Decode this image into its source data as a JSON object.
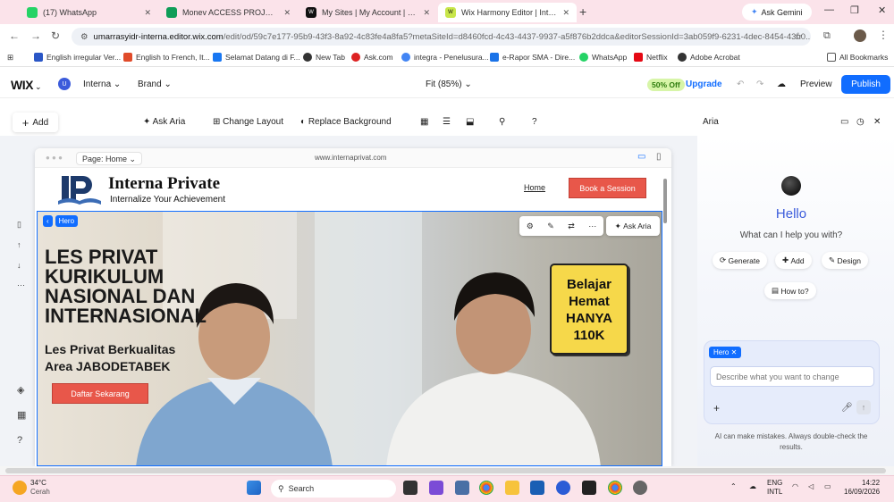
{
  "browser": {
    "tabs": [
      {
        "title": "(17) WhatsApp",
        "icon": "whatsapp-icon",
        "color": "#25d366"
      },
      {
        "title": "Monev ACCESS PROJECT 2026 -",
        "icon": "sheets-icon",
        "color": "#0f9d58"
      },
      {
        "title": "My Sites | My Account | Wix.com",
        "icon": "wix-icon",
        "color": "#111111"
      },
      {
        "title": "Wix Harmony Editor | Interna",
        "icon": "wix-icon",
        "color": "#c8e64a"
      }
    ],
    "ask_gemini": "Ask Gemini",
    "url_host": "umarrasyidr-interna.editor.wix.com",
    "url_path": "/edit/od/59c7e177-95b9-43f3-8a92-4c83fe4a8fa5?metaSiteId=d8460fcd-4c43-4437-9937-a5f876b2ddca&editorSessionId=3ab059f9-6231-4dec-8454-43b0...",
    "bookmarks": [
      {
        "label": "English irregular Ver...",
        "color": "#2a56c6"
      },
      {
        "label": "English to French, It...",
        "color": "#e04b2a"
      },
      {
        "label": "Selamat Datang di F...",
        "color": "#1877f2"
      },
      {
        "label": "New Tab",
        "color": "#333333"
      },
      {
        "label": "Ask.com",
        "color": "#d22"
      },
      {
        "label": "integra - Penelusura...",
        "color": "#4285f4"
      },
      {
        "label": "e-Rapor SMA - Dire...",
        "color": "#1a73e8"
      },
      {
        "label": "WhatsApp",
        "color": "#25d366"
      },
      {
        "label": "Netflix",
        "color": "#e50914"
      },
      {
        "label": "Adobe Acrobat",
        "color": "#333333"
      }
    ],
    "all_bookmarks": "All Bookmarks"
  },
  "editor": {
    "logo": "WIX",
    "site_initial": "U",
    "site_name": "Interna",
    "brand": "Brand",
    "zoom": "Fit (85%)",
    "discount": "50% Off",
    "upgrade": "Upgrade",
    "preview": "Preview",
    "publish": "Publish",
    "add": "Add",
    "ask_aria": "Ask Aria",
    "change_layout": "Change Layout",
    "replace_background": "Replace Background",
    "aria_title": "Aria",
    "page_label": "Page: Home",
    "frame_url": "www.internaprivat.com"
  },
  "site": {
    "brand_name": "Interna Private",
    "tagline": "Internalize Your Achievement",
    "nav_home": "Home",
    "nav_book": "Book a Session",
    "hero_title": "LES PRIVAT KURIKULUM NASIONAL DAN INTERNASIONAL",
    "hero_subtitle_1": "Les Privat Berkualitas",
    "hero_subtitle_2": "Area JABODETABEK",
    "cta": "Daftar Sekarang",
    "promo": [
      "Belajar",
      "Hemat",
      "HANYA",
      "110K"
    ],
    "section_tag": "Hero",
    "ask_aria": "Ask Aria"
  },
  "aria": {
    "hello": "Hello",
    "help": "What can I help you with?",
    "chips": [
      "Generate",
      "Add",
      "Design",
      "How to?"
    ],
    "context_chip": "Hero",
    "placeholder": "Describe what you want to change",
    "disclaimer": "AI can make mistakes. Always double-check the results."
  },
  "taskbar": {
    "weather_temp": "34°C",
    "weather_text": "Cerah",
    "search": "Search",
    "lang_1": "ENG",
    "lang_2": "INTL",
    "time": "14:22",
    "date": "16/09/2026"
  }
}
